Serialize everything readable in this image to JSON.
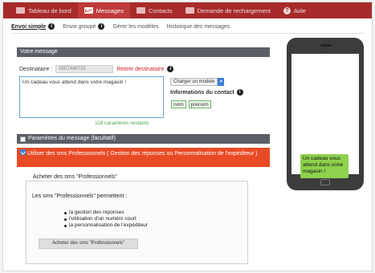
{
  "topnav": {
    "items": [
      {
        "label": "Tableau de bord",
        "icon": "dashboard-icon"
      },
      {
        "label": "Messages",
        "icon": "envelope-icon",
        "active": true
      },
      {
        "label": "Contacts",
        "icon": "contacts-icon"
      },
      {
        "label": "Demande de rechargement",
        "icon": "recharge-icon"
      },
      {
        "label": "Aide",
        "icon": "help-icon"
      }
    ]
  },
  "subnav": {
    "items": [
      "Envoi simple",
      "Envoi groupé",
      "Gérer les modèles",
      "Historique des messages"
    ]
  },
  "compose": {
    "header": "Votre message",
    "recipient_label": "Destinataire :",
    "recipient_value": "0607448732",
    "remove_label": "Retirer destinataire",
    "message": "Un cadeau vous attend dans votre magasin !",
    "counter": "118 caractères restants",
    "model_select": "Charger un modèle",
    "contact_info": "Informations du contact",
    "tags": [
      "nom",
      "prenom"
    ]
  },
  "params": {
    "label": "Paramètres du message (facultatif)",
    "pro_sms": "Utiliser des sms Professionnels ( Gestion des réponses ou Personnalisation de l'expéditeur )"
  },
  "pro_box": {
    "legend": "Acheter des sms \"Professionnels\"",
    "intro": "Les sms \"Professionnels\" permettent :",
    "features": [
      "la gestion des réponses",
      "l'utilisation d'un numéro court",
      "la personnalisation de l'expéditeur"
    ],
    "button": "Acheter des sms \"Professionnels\""
  },
  "preview": {
    "bubble": "Un cadeau vous attend dans votre magasin !"
  },
  "colors": {
    "nav": "#a72b2b",
    "orange": "#e84a25",
    "bubble": "#8ed14d",
    "section": "#5a5f66"
  }
}
